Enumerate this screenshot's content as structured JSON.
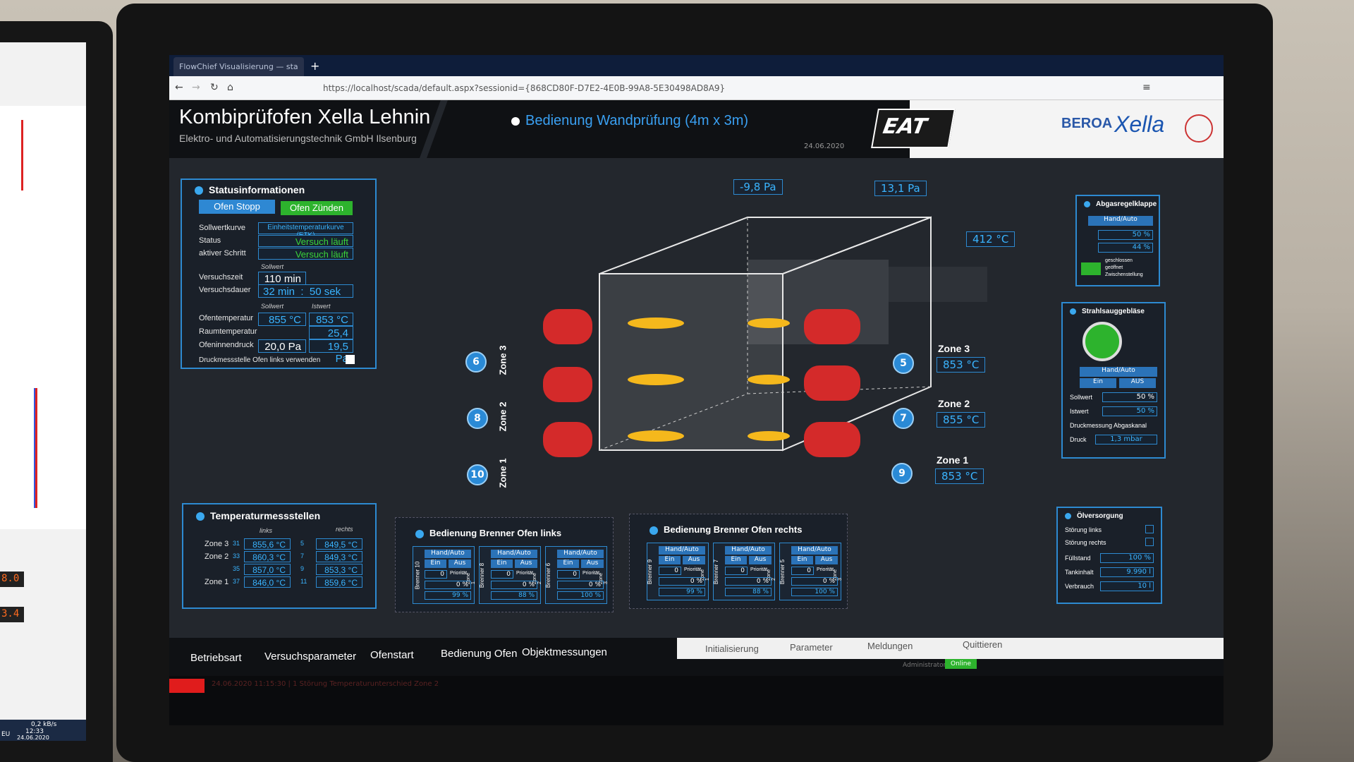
{
  "browser": {
    "tab_title": "FlowChief Visualisierung — sta",
    "url": "https://localhost/scada/default.aspx?sessionid={868CD80F-D7E2-4E0B-99A8-5E30498AD8A9}"
  },
  "header": {
    "title": "Kombiprüfofen Xella Lehnin",
    "subtitle": "Elektro- und Automatisierungstechnik GmbH Ilsenburg",
    "mode": "Bedienung Wandprüfung (4m x 3m)",
    "date": "24.06.2020",
    "logo_eat": "EAT",
    "logo_beroa": "BEROA",
    "logo_xella": "Xella"
  },
  "status": {
    "title": "Statusinformationen",
    "btn_stop": "Ofen Stopp",
    "btn_ignite": "Ofen Zünden",
    "rows": [
      {
        "label": "Sollwertkurve",
        "value": "Einheitstemperaturkurve (ETK)"
      },
      {
        "label": "Status",
        "value": "Versuch läuft"
      },
      {
        "label": "aktiver Schritt",
        "value": "Versuch läuft"
      }
    ],
    "sollwert_hdr": "Sollwert",
    "versuchszeit_label": "Versuchszeit",
    "versuchszeit": "110 min",
    "versuchsdauer_label": "Versuchsdauer",
    "dauer_min": "32 min",
    "dauer_sep": ":",
    "dauer_sek": "50 sek",
    "col_soll": "Sollwert",
    "col_ist": "Istwert",
    "ofentemp_label": "Ofentemperatur",
    "ofentemp_soll": "855 °C",
    "ofentemp_ist": "853 °C",
    "raumtemp_label": "Raumtemperatur",
    "raumtemp_ist": "25,4 °C",
    "druck_label": "Ofeninnendruck",
    "druck_soll": "20,0 Pa",
    "druck_ist": "19,5 Pa",
    "checkbox_label": "Druckmessstelle Ofen links verwenden"
  },
  "furnace": {
    "pressure_left": "-9,8 Pa",
    "pressure_right": "13,1 Pa",
    "exhaust_temp": "412 °C",
    "zones": [
      {
        "name": "Zone 3",
        "temp": "853 °C",
        "left_badge": "6",
        "right_badge": "5"
      },
      {
        "name": "Zone 2",
        "temp": "855 °C",
        "left_badge": "8",
        "right_badge": "7"
      },
      {
        "name": "Zone 1",
        "temp": "853 °C",
        "left_badge": "10",
        "right_badge": "9"
      }
    ]
  },
  "abgas": {
    "title": "Abgasregelklappe",
    "handauto": "Hand/Auto",
    "val1": "50 %",
    "val2": "44 %",
    "legend1": "geschlossen",
    "legend2": "geöffnet",
    "legend3": "Zwischenstellung"
  },
  "strahl": {
    "title": "Strahlsauggebläse",
    "handauto": "Hand/Auto",
    "ein": "Ein",
    "aus": "AUS",
    "soll_label": "Sollwert",
    "soll": "50 %",
    "ist_label": "Istwert",
    "ist": "50 %",
    "druck_hdr": "Druckmessung Abgaskanal",
    "druck_label": "Druck",
    "druck": "1,3 mbar"
  },
  "tempmess": {
    "title": "Temperaturmessstellen",
    "col_left": "links",
    "col_right": "rechts",
    "rows": [
      {
        "zone": "Zone 3",
        "ln": "31",
        "lv": "855,6 °C",
        "rn": "5",
        "rv": "849,5 °C"
      },
      {
        "zone": "Zone 2",
        "ln": "33",
        "lv": "860,3 °C",
        "rn": "7",
        "rv": "849,3 °C"
      },
      {
        "zone": "",
        "ln": "35",
        "lv": "857,0 °C",
        "rn": "9",
        "rv": "853,3 °C"
      },
      {
        "zone": "Zone 1",
        "ln": "37",
        "lv": "846,0 °C",
        "rn": "11",
        "rv": "859,6 °C"
      }
    ]
  },
  "brenner_links": {
    "title": "Bedienung Brenner Ofen links",
    "units": [
      {
        "name": "Brenner 10",
        "zone": "Zone 1",
        "prio": "0",
        "pct": "0 %",
        "out": "99 %"
      },
      {
        "name": "Brenner 8",
        "zone": "Zone 2",
        "prio": "0",
        "pct": "0 %",
        "out": "88 %"
      },
      {
        "name": "Brenner 6",
        "zone": "Zone 3",
        "prio": "0",
        "pct": "0 %",
        "out": "100 %"
      }
    ],
    "handauto": "Hand/Auto",
    "ein": "Ein",
    "aus": "Aus",
    "prio_label": "Priorität"
  },
  "brenner_rechts": {
    "title": "Bedienung Brenner Ofen rechts",
    "units": [
      {
        "name": "Brenner 9",
        "zone": "Zone 1",
        "prio": "0",
        "pct": "0 %",
        "out": "99 %"
      },
      {
        "name": "Brenner 7",
        "zone": "Zone 2",
        "prio": "0",
        "pct": "0 %",
        "out": "88 %"
      },
      {
        "name": "Brenner 5",
        "zone": "Zone 3",
        "prio": "0",
        "pct": "0 %",
        "out": "100 %"
      }
    ],
    "handauto": "Hand/Auto",
    "ein": "Ein",
    "aus": "Aus",
    "prio_label": "Priorität"
  },
  "oel": {
    "title": "Ölversorgung",
    "stoer_links": "Störung links",
    "stoer_rechts": "Störung rechts",
    "fuell_label": "Füllstand",
    "fuell": "100 %",
    "tank_label": "Tankinhalt",
    "tank": "9.990 l",
    "verb_label": "Verbrauch",
    "verb": "10 l"
  },
  "bottom": {
    "tabs": [
      "Betriebsart",
      "Versuchsparameter",
      "Ofenstart",
      "Bedienung Ofen",
      "Objektmessungen"
    ],
    "tabs2": [
      "Initialisierung",
      "Parameter",
      "Meldungen",
      "Quittieren"
    ],
    "user": "Administrator",
    "online": "Online",
    "alarm": "24.06.2020 11:15:30 | 1 Störung Temperaturunterschied Zone 2"
  },
  "side": {
    "speed": "0,2 kB/s",
    "time": "12:33",
    "date": "24.06.2020",
    "lang": "EU",
    "led1": "8.0",
    "led2": "3.4"
  }
}
